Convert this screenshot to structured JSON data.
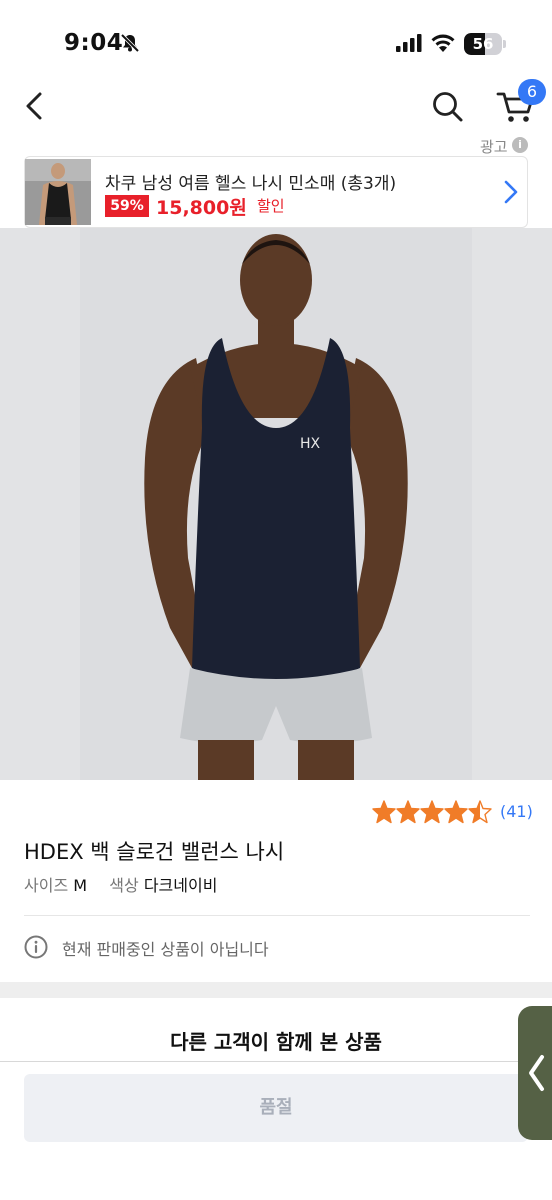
{
  "status_bar": {
    "time": "9:04",
    "battery": "56",
    "battery_level": 0.56,
    "icons": [
      "bell-slash-icon",
      "signal-icon",
      "wifi-icon",
      "battery-icon"
    ]
  },
  "header": {
    "back_icon": "chevron-left-icon",
    "search_icon": "search-icon",
    "cart_icon": "cart-icon",
    "cart_count": "6"
  },
  "ad": {
    "label": "광고",
    "info_icon": "info-icon",
    "title": "차쿠 남성 여름 헬스 나시 민소매 (총3개)",
    "discount": "59%",
    "price": "15,800원",
    "sale_tag": "할인"
  },
  "product": {
    "rating": 4.5,
    "review_count": "(41)",
    "name": "HDEX 백 슬로건 밸런스 나시",
    "size_label": "사이즈",
    "size_value": "M",
    "color_label": "색상",
    "color_value": "다크네이비",
    "notice": "현재 판매중인 상품이 아닙니다"
  },
  "recommend": {
    "title": "다른 고객이 함께 본 상품",
    "soldout_label": "품절"
  },
  "colors": {
    "accent": "#3478f6",
    "sale_red": "#e8202a",
    "star": "#f07c28",
    "side_tab": "#556145"
  }
}
